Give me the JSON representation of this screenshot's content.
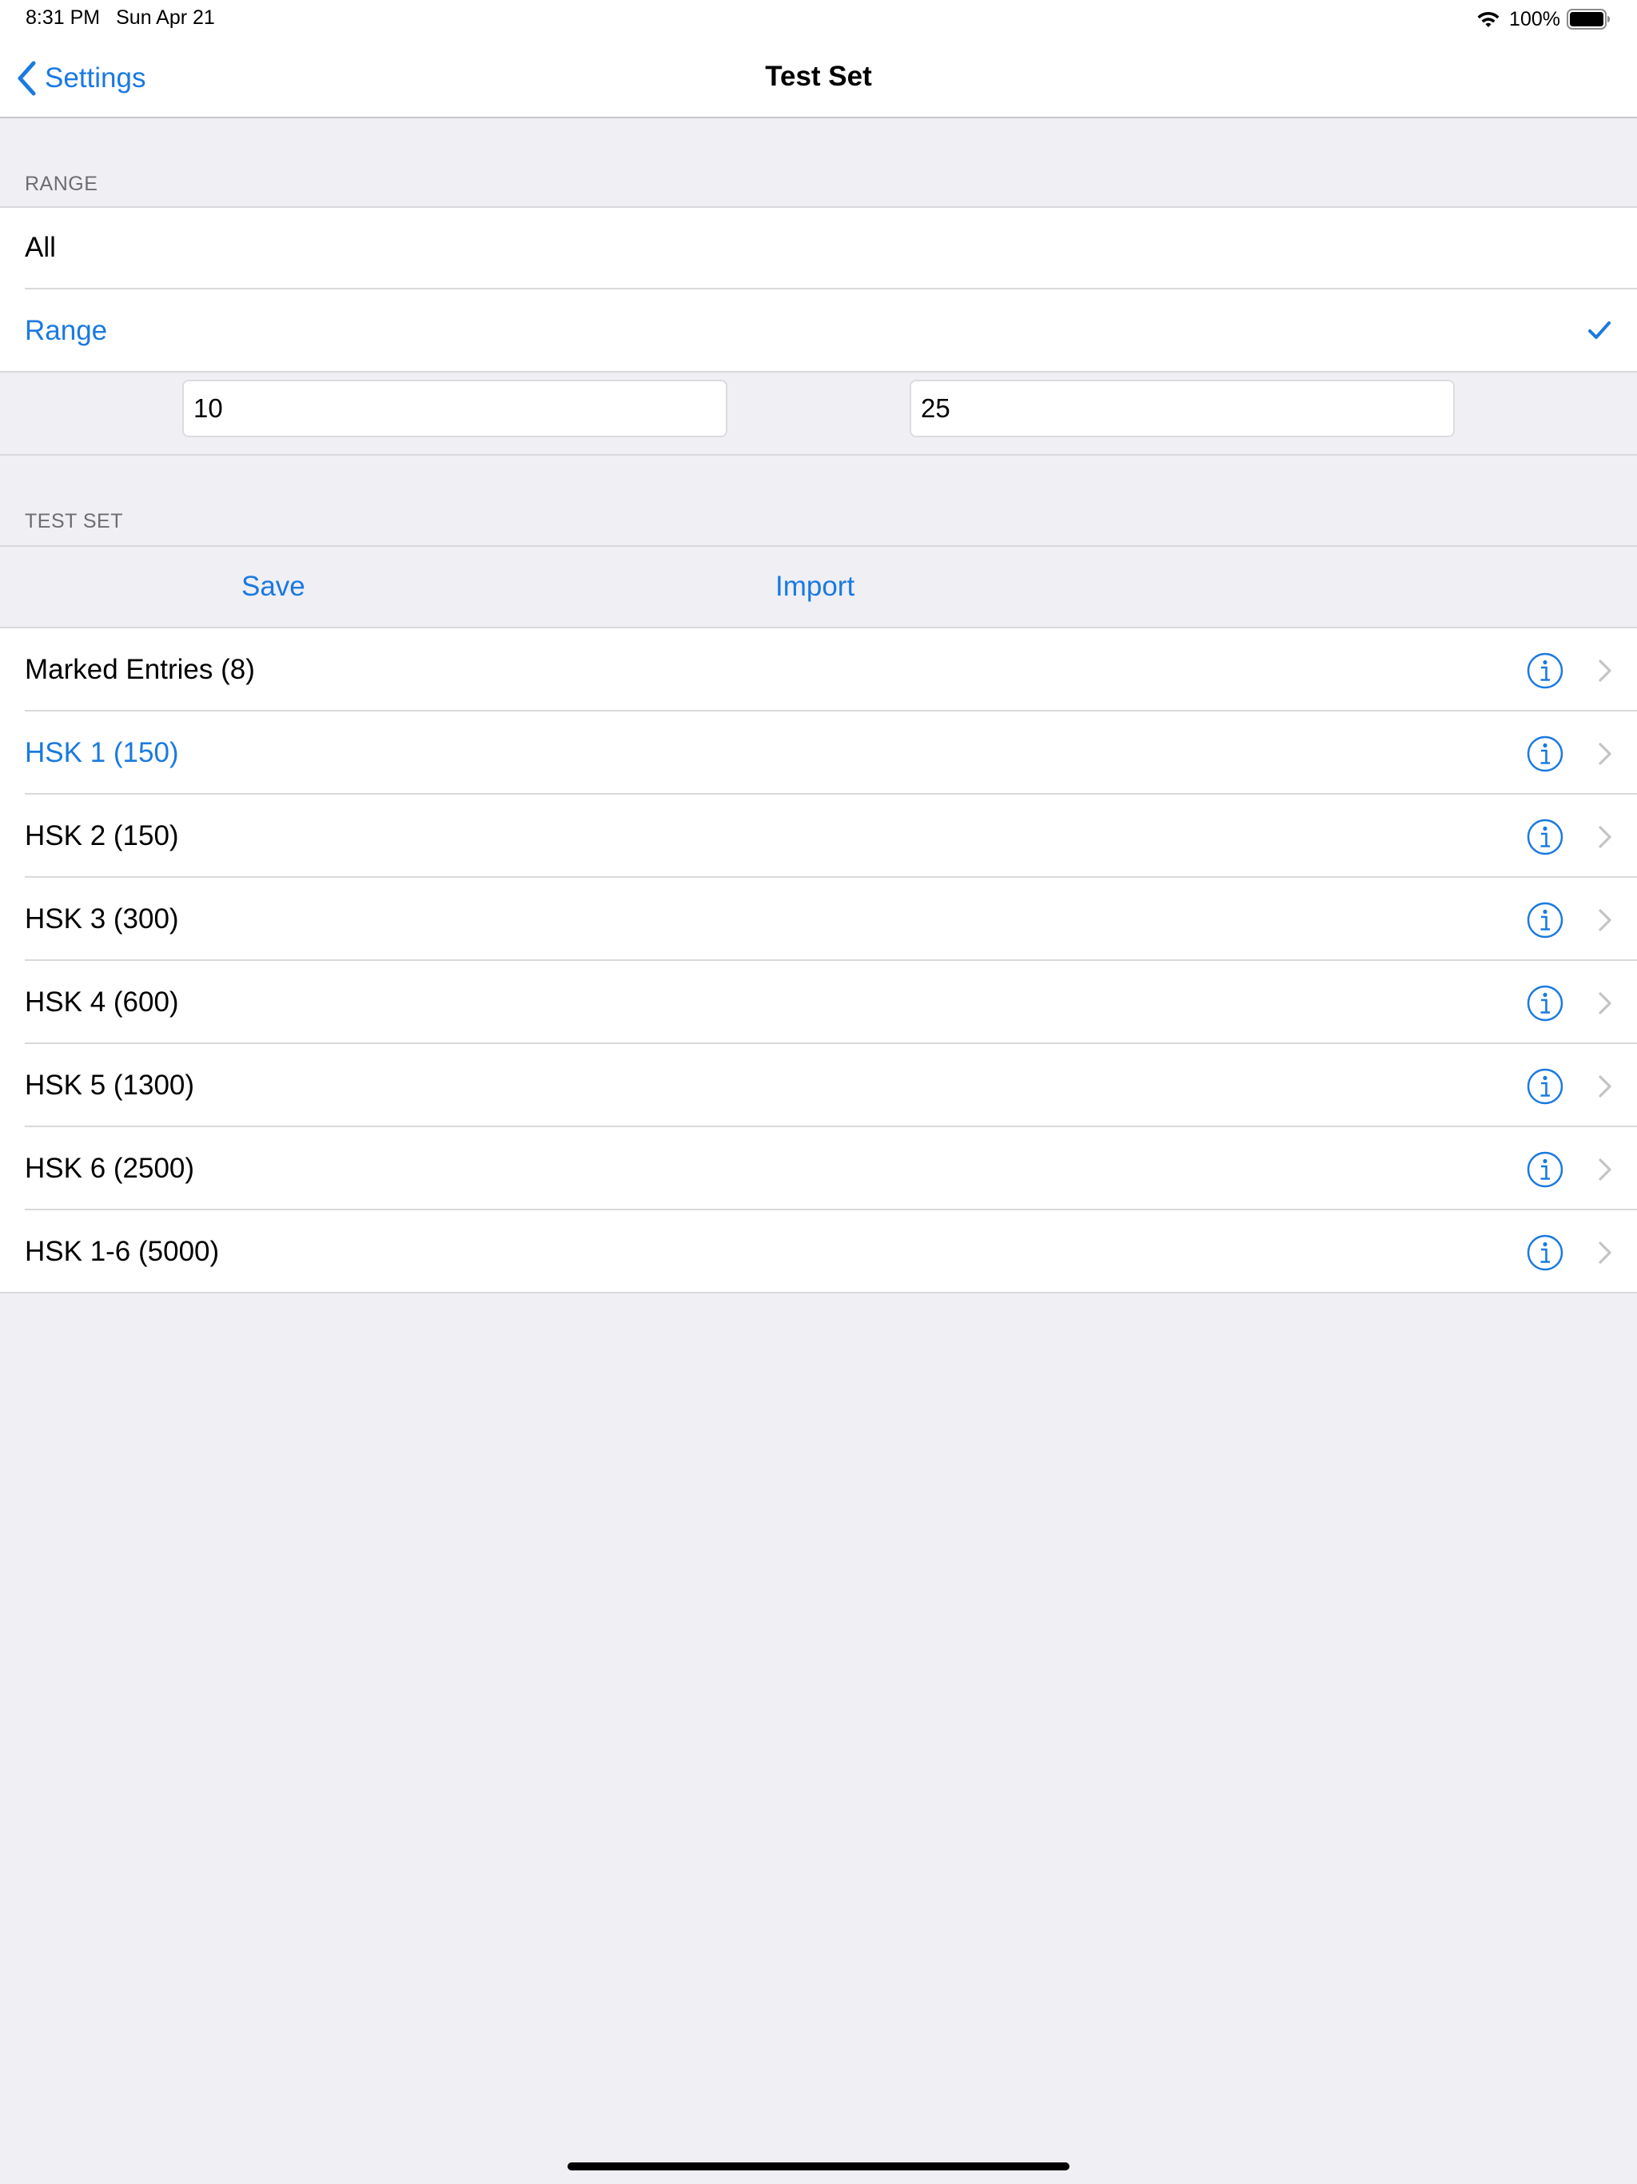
{
  "status_bar": {
    "time": "8:31 PM",
    "date": "Sun Apr 21",
    "battery": "100%"
  },
  "nav": {
    "back_label": "Settings",
    "title": "Test Set"
  },
  "range_section": {
    "header": "RANGE",
    "options": [
      {
        "label": "All",
        "selected": false
      },
      {
        "label": "Range",
        "selected": true
      }
    ],
    "from_value": "10",
    "to_value": "25"
  },
  "test_set_section": {
    "header": "TEST SET",
    "save_label": "Save",
    "import_label": "Import",
    "items": [
      {
        "label": "Marked Entries (8)",
        "selected": false
      },
      {
        "label": "HSK 1 (150)",
        "selected": true
      },
      {
        "label": "HSK 2 (150)",
        "selected": false
      },
      {
        "label": "HSK 3 (300)",
        "selected": false
      },
      {
        "label": "HSK 4 (600)",
        "selected": false
      },
      {
        "label": "HSK 5 (1300)",
        "selected": false
      },
      {
        "label": "HSK 6 (2500)",
        "selected": false
      },
      {
        "label": "HSK 1-6 (5000)",
        "selected": false
      }
    ]
  },
  "colors": {
    "accent": "#1a7ae0",
    "background": "#efeff4",
    "separator": "#d9d9dc",
    "section_header_text": "#6d6d72"
  },
  "icons": {
    "back": "chevron-left-icon",
    "selected": "checkmark-icon",
    "detail": "info-icon",
    "disclosure": "chevron-right-icon",
    "wifi": "wifi-icon",
    "battery": "battery-icon"
  }
}
